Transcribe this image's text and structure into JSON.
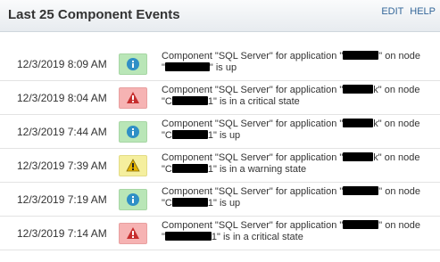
{
  "header": {
    "title": "Last 25 Component Events",
    "edit_label": "EDIT",
    "help_label": "HELP"
  },
  "events": [
    {
      "timestamp": "12/3/2019 8:09 AM",
      "severity": "info",
      "icon": "info-icon",
      "msg_start": "Component \"SQL Server\" for application \"",
      "app_tail": "",
      "msg_mid": "\" on node",
      "node_head": "\"",
      "node_tail": "\" is up"
    },
    {
      "timestamp": "12/3/2019 8:04 AM",
      "severity": "critical",
      "icon": "critical-icon",
      "msg_start": "Component \"SQL Server\" for application \"",
      "app_tail": "k",
      "msg_mid": "\" on node",
      "node_head": "\"C",
      "node_tail": "1\" is in a critical state"
    },
    {
      "timestamp": "12/3/2019 7:44 AM",
      "severity": "info",
      "icon": "info-icon",
      "msg_start": "Component \"SQL Server\" for application \"",
      "app_tail": "k",
      "msg_mid": "\" on node",
      "node_head": "\"C",
      "node_tail": "1\" is up"
    },
    {
      "timestamp": "12/3/2019 7:39 AM",
      "severity": "warning",
      "icon": "warning-icon",
      "msg_start": "Component \"SQL Server\" for application \"",
      "app_tail": "k",
      "msg_mid": "\" on node",
      "node_head": "\"C",
      "node_tail": "1\" is in a warning state"
    },
    {
      "timestamp": "12/3/2019 7:19 AM",
      "severity": "info",
      "icon": "info-icon",
      "msg_start": "Component \"SQL Server\" for application \"",
      "app_tail": "",
      "msg_mid": "\" on node",
      "node_head": "\"C",
      "node_tail": "1\" is up"
    },
    {
      "timestamp": "12/3/2019 7:14 AM",
      "severity": "critical",
      "icon": "critical-icon",
      "msg_start": "Component \"SQL Server\" for application \"",
      "app_tail": "",
      "msg_mid": "\" on node",
      "node_head": "\"",
      "node_tail": "1\" is in a critical state"
    }
  ],
  "colors": {
    "info_bg": "#b9e6b7",
    "critical_bg": "#f6b3b3",
    "warning_bg": "#f5ef9e",
    "link": "#336699"
  }
}
